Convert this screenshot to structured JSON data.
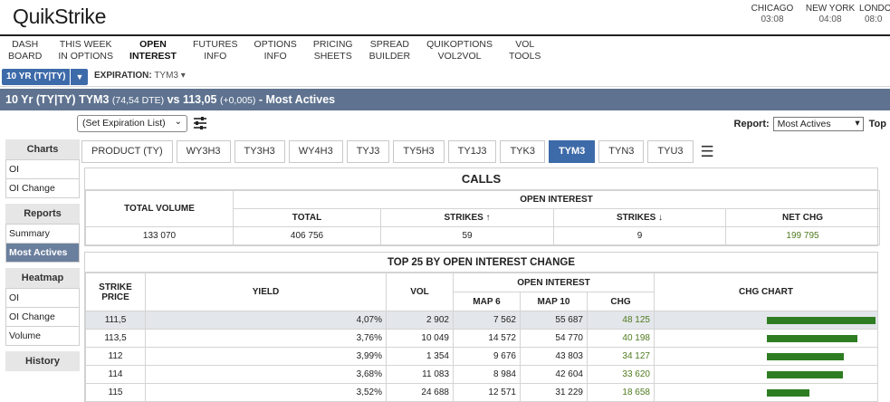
{
  "app": {
    "logo": "QuikStrike"
  },
  "clocks": [
    {
      "city": "CHICAGO",
      "time": "03:08"
    },
    {
      "city": "NEW YORK",
      "time": "04:08"
    },
    {
      "city": "LONDO",
      "time": "08:0"
    }
  ],
  "nav": [
    {
      "l1": "DASH",
      "l2": "BOARD"
    },
    {
      "l1": "THIS WEEK",
      "l2": "IN OPTIONS"
    },
    {
      "l1": "OPEN",
      "l2": "INTEREST"
    },
    {
      "l1": "FUTURES",
      "l2": "INFO"
    },
    {
      "l1": "OPTIONS",
      "l2": "INFO"
    },
    {
      "l1": "PRICING",
      "l2": "SHEETS"
    },
    {
      "l1": "SPREAD",
      "l2": "BUILDER"
    },
    {
      "l1": "QUIKOPTIONS",
      "l2": "VOL2VOL"
    },
    {
      "l1": "VOL",
      "l2": "TOOLS"
    }
  ],
  "product_selector": {
    "label": "10 YR (TY|TY)",
    "expiration_label": "EXPIRATION:",
    "expiration_value": "TYM3"
  },
  "title": {
    "main": "10 Yr (TY|TY) TYM3",
    "detail": "(74,54 DTE)",
    "vs": "vs 113,05",
    "chg": "(+0,005)",
    "suffix": "- Most Actives"
  },
  "set_expiration": "(Set Expiration List)",
  "report": {
    "label": "Report:",
    "value": "Most Actives",
    "extra": "Top"
  },
  "sidebar": {
    "charts_head": "Charts",
    "charts": [
      "OI",
      "OI Change"
    ],
    "reports_head": "Reports",
    "reports": [
      "Summary",
      "Most Actives"
    ],
    "heatmap_head": "Heatmap",
    "heatmap": [
      "OI",
      "OI Change",
      "Volume"
    ],
    "history_head": "History"
  },
  "tabs": [
    "PRODUCT (TY)",
    "WY3H3",
    "TY3H3",
    "WY4H3",
    "TYJ3",
    "TY5H3",
    "TY1J3",
    "TYK3",
    "TYM3",
    "TYN3",
    "TYU3"
  ],
  "tab_selected": "TYM3",
  "calls": {
    "title": "CALLS",
    "total_volume_header": "TOTAL VOLUME",
    "oi_header": "OPEN INTEREST",
    "cols": [
      "TOTAL",
      "STRIKES ↑",
      "STRIKES ↓",
      "NET CHG"
    ],
    "total_volume": "133 070",
    "total": "406 756",
    "strikes_up": "59",
    "strikes_down": "9",
    "net_chg": "199 795"
  },
  "top25": {
    "title": "TOP 25 BY OPEN INTEREST CHANGE",
    "headers": {
      "strike": "STRIKE PRICE",
      "yield": "YIELD",
      "vol": "VOL",
      "oi": "OPEN INTEREST",
      "map6": "MAP 6",
      "map10": "MAP 10",
      "chg": "CHG",
      "chart": "CHG CHART"
    },
    "rows": [
      {
        "strike": "111,5",
        "yield": "4,07%",
        "vol": "2 902",
        "map6": "7 562",
        "map10": "55 687",
        "chg": "48 125",
        "chg_value": 48125
      },
      {
        "strike": "113,5",
        "yield": "3,76%",
        "vol": "10 049",
        "map6": "14 572",
        "map10": "54 770",
        "chg": "40 198",
        "chg_value": 40198
      },
      {
        "strike": "112",
        "yield": "3,99%",
        "vol": "1 354",
        "map6": "9 676",
        "map10": "43 803",
        "chg": "34 127",
        "chg_value": 34127
      },
      {
        "strike": "114",
        "yield": "3,68%",
        "vol": "11 083",
        "map6": "8 984",
        "map10": "42 604",
        "chg": "33 620",
        "chg_value": 33620
      },
      {
        "strike": "115",
        "yield": "3,52%",
        "vol": "24 688",
        "map6": "12 571",
        "map10": "31 229",
        "chg": "18 658",
        "chg_value": 18658
      }
    ]
  },
  "colors": {
    "accent": "#3d6aa9",
    "title_bar": "#5f7390",
    "bar": "#2e7d22",
    "positive": "#4f7a1e"
  }
}
